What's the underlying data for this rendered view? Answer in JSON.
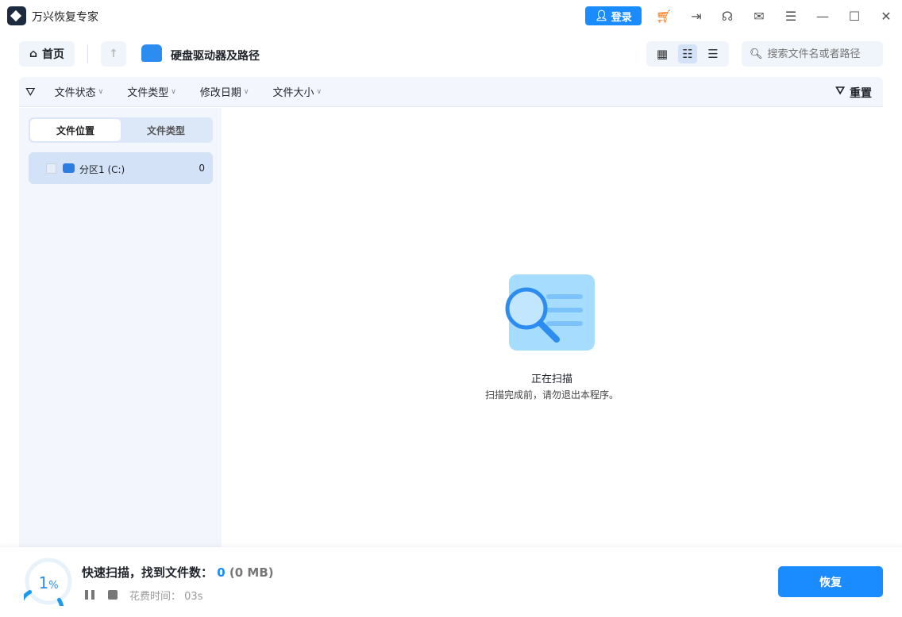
{
  "app": {
    "title": "万兴恢复专家",
    "login": "登录"
  },
  "nav": {
    "home": "首页",
    "breadcrumb": "硬盘驱动器及路径",
    "search_placeholder": "搜索文件名或者路径"
  },
  "filters": {
    "items": [
      "文件状态",
      "文件类型",
      "修改日期",
      "文件大小"
    ],
    "reset": "重置"
  },
  "sidebar": {
    "tabs": [
      "文件位置",
      "文件类型"
    ],
    "partition": {
      "label": "分区1 (C:)",
      "count": "0"
    }
  },
  "main": {
    "status_title": "正在扫描",
    "status_hint": "扫描完成前，请勿退出本程序。"
  },
  "footer": {
    "progress_value": "1",
    "progress_unit": "%",
    "scan_label": "快速扫描，找到文件数：",
    "found_count": "0",
    "found_size": "(0 MB)",
    "time_label": "花费时间：",
    "time_value": "03s",
    "recover": "恢复"
  },
  "colors": {
    "accent": "#1a8cff",
    "cart": "#ff6a00"
  }
}
